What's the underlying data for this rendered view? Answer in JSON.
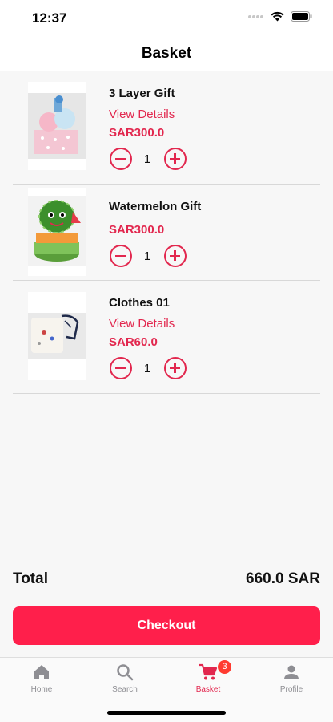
{
  "status_bar": {
    "time": "12:37"
  },
  "nav": {
    "title": "Basket"
  },
  "items": [
    {
      "name": "3 Layer Gift",
      "details_label": "View Details",
      "price": "SAR300.0",
      "quantity": "1"
    },
    {
      "name": "Watermelon Gift",
      "price": "SAR300.0",
      "quantity": "1"
    },
    {
      "name": "Clothes 01",
      "details_label": "View Details",
      "price": "SAR60.0",
      "quantity": "1"
    }
  ],
  "summary": {
    "total_label": "Total",
    "total_value": "660.0 SAR"
  },
  "checkout_label": "Checkout",
  "tabs": [
    {
      "label": "Home",
      "icon": "home-icon"
    },
    {
      "label": "Search",
      "icon": "search-icon"
    },
    {
      "label": "Basket",
      "icon": "cart-icon",
      "badge": "3",
      "active": true
    },
    {
      "label": "Profile",
      "icon": "person-icon"
    }
  ],
  "colors": {
    "accent": "#e2274e",
    "button": "#ff1f4b",
    "badge": "#ff3b30",
    "inactive": "#8e8e93"
  }
}
